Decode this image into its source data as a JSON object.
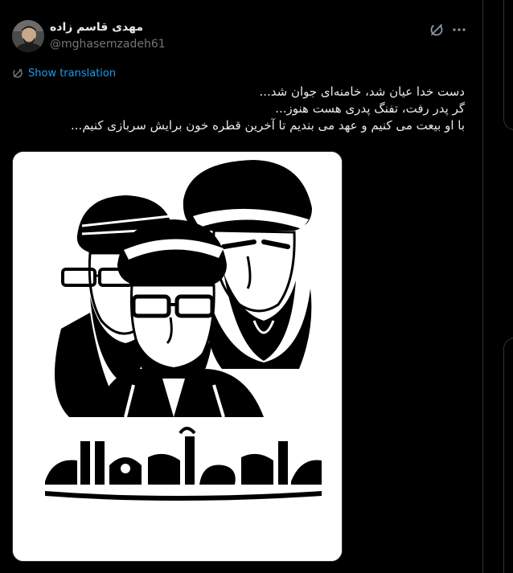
{
  "author": {
    "display_name": "مهدی قاسم زاده",
    "handle": "@mghasemzadeh61"
  },
  "icons": {
    "avatar": "avatar",
    "grok": "grok-icon",
    "more": "more-horizontal-icon",
    "translate": "translate-icon"
  },
  "translate": {
    "label": "Show translation"
  },
  "tweet": {
    "lines": [
      "دست خدا عیان شد، خامنه‌ای جوان شد...",
      "گر پدر رفت، تفنگ پدری هست هنوز...",
      "با او بیعت می کنیم و عهد می بندیم تا آخرین قطره خون برایش سربازی کنیم..."
    ]
  },
  "media": {
    "poster_caption": "صالحٌ بعد صالح"
  },
  "colors": {
    "background": "#000000",
    "text": "#e7e9ea",
    "secondary": "#71767b",
    "link": "#1d9bf0",
    "border": "#2f3336"
  }
}
